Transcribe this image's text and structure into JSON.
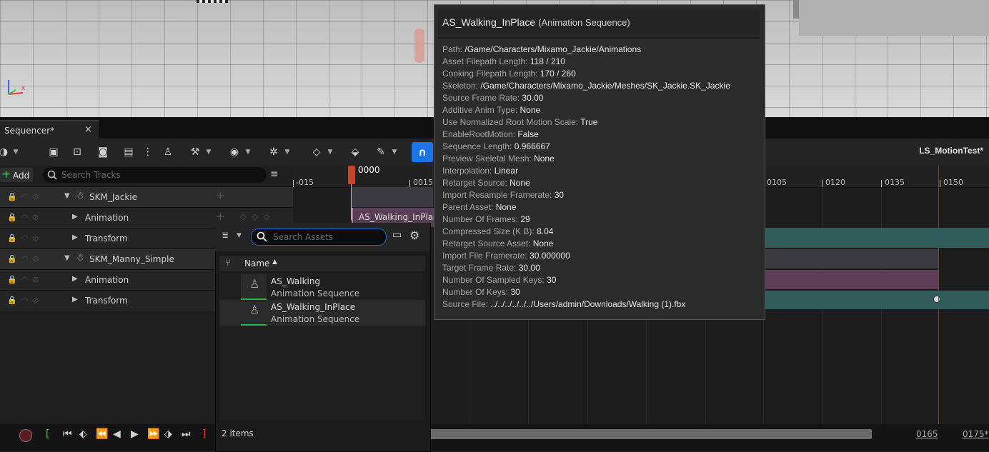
{
  "tab": {
    "label": "Sequencer*",
    "close": "×"
  },
  "toolbar": {
    "sequence_name": "LS_MotionTest*",
    "add_label": "Add",
    "add_plus": "+"
  },
  "track_search": {
    "placeholder": "Search Tracks"
  },
  "tracks": [
    {
      "label": "SKM_Jackie"
    },
    {
      "label": "Animation"
    },
    {
      "label": "Transform"
    },
    {
      "label": "SKM_Manny_Simple"
    },
    {
      "label": "Animation"
    },
    {
      "label": "Transform"
    }
  ],
  "timeline": {
    "playhead_frame": "0000",
    "ticks": [
      "-015",
      "0015",
      "0105",
      "0120",
      "0135",
      "0150"
    ],
    "section_label": "AS_Walking_InPlace",
    "frame_a": "0165",
    "frame_b": "0175*"
  },
  "asset_picker": {
    "search_placeholder": "Search Assets",
    "column_name": "Name",
    "items": [
      {
        "name": "AS_Walking",
        "type": "Animation Sequence"
      },
      {
        "name": "AS_Walking_InPlace",
        "type": "Animation Sequence"
      }
    ],
    "count": "2 items"
  },
  "tooltip": {
    "title": "AS_Walking_InPlace",
    "kind": "(Animation Sequence)",
    "rows": [
      {
        "key": "Path:",
        "value": "/Game/Characters/Mixamo_Jackie/Animations"
      },
      {
        "key": "Asset Filepath Length:",
        "value": "118 / 210"
      },
      {
        "key": "Cooking Filepath Length:",
        "value": "170 / 260"
      },
      {
        "key": "Skeleton:",
        "value": "/Game/Characters/Mixamo_Jackie/Meshes/SK_Jackie.SK_Jackie"
      },
      {
        "key": "Source Frame Rate:",
        "value": "30.00"
      },
      {
        "key": "Additive Anim Type:",
        "value": "None"
      },
      {
        "key": "Use Normalized Root Motion Scale:",
        "value": "True"
      },
      {
        "key": "EnableRootMotion:",
        "value": "False"
      },
      {
        "key": "Sequence Length:",
        "value": "0.966667"
      },
      {
        "key": "Preview Skeletal Mesh:",
        "value": "None"
      },
      {
        "key": "Interpolation:",
        "value": "Linear"
      },
      {
        "key": "Retarget Source:",
        "value": "None"
      },
      {
        "key": "Import Resample Framerate:",
        "value": "30"
      },
      {
        "key": "Parent Asset:",
        "value": "None"
      },
      {
        "key": "Number Of Frames:",
        "value": "29"
      },
      {
        "key": "Compressed Size (K B):",
        "value": "8.04"
      },
      {
        "key": "Retarget Source Asset:",
        "value": "None"
      },
      {
        "key": "Import File Framerate:",
        "value": "30.000000"
      },
      {
        "key": "Target Frame Rate:",
        "value": "30.00"
      },
      {
        "key": "Number Of Sampled Keys:",
        "value": "30"
      },
      {
        "key": "Number Of Keys:",
        "value": "30"
      },
      {
        "key": "Source File:",
        "value": "../../../../../../Users/admin/Downloads/Walking (1).fbx"
      }
    ]
  },
  "colors": {
    "accent": "#1a73e8",
    "playhead": "#c4452a",
    "end_marker": "#b5232a",
    "anim_section": "#5a3d55",
    "transform_section": "#2f5c59",
    "add_plus": "#3bd14b"
  },
  "icons": [
    "gear-icon",
    "search-icon",
    "filter-icon",
    "magnet-icon",
    "eye-icon",
    "wrench-icon",
    "folder-icon",
    "sort-asc-icon",
    "skeleton-icon"
  ]
}
